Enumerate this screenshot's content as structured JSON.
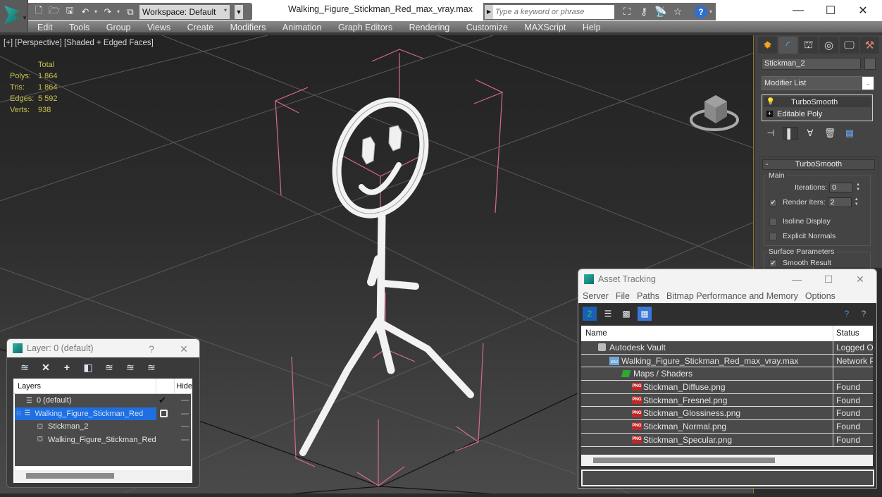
{
  "titlebar": {
    "workspace": "Workspace: Default",
    "document_title": "Walking_Figure_Stickman_Red_max_vray.max",
    "search_placeholder": "Type a keyword or phrase",
    "quick_access": [
      "new-file-icon",
      "open-file-icon",
      "save-icon",
      "undo-icon",
      "redo-icon",
      "project-folder-icon"
    ],
    "search_tools": [
      "binoculars-icon",
      "key-icon",
      "satellite-icon",
      "star-icon"
    ],
    "window_buttons": {
      "minimize": "—",
      "maximize": "☐",
      "close": "✕"
    }
  },
  "menubar": {
    "items": [
      "Edit",
      "Tools",
      "Group",
      "Views",
      "Create",
      "Modifiers",
      "Animation",
      "Graph Editors",
      "Rendering",
      "Customize",
      "MAXScript",
      "Help"
    ]
  },
  "viewport": {
    "label": "[+] [Perspective] [Shaded + Edged Faces]",
    "stats": {
      "header": "Total",
      "rows": [
        {
          "key": "Polys:",
          "value": "1 864"
        },
        {
          "key": "Tris:",
          "value": "1 864"
        },
        {
          "key": "Edges:",
          "value": "5 592"
        },
        {
          "key": "Verts:",
          "value": "938"
        }
      ]
    },
    "accent_color": "#d86a8a"
  },
  "command_panel": {
    "tabs": [
      "create-icon",
      "modify-icon",
      "hierarchy-icon",
      "motion-icon",
      "display-icon",
      "utilities-icon"
    ],
    "object_name": "Stickman_2",
    "modifier_list": "Modifier List",
    "stack": [
      {
        "label": "TurboSmooth",
        "icon": "lightbulb-icon",
        "selected": true
      },
      {
        "label": "Editable Poly",
        "icon": "expand-icon",
        "selected": false
      }
    ],
    "rollout": {
      "title": "TurboSmooth",
      "collapse": "-",
      "main_group": "Main",
      "iterations_label": "Iterations:",
      "iterations_value": "0",
      "render_iters_label": "Render Iters:",
      "render_iters_value": "2",
      "render_iters_checked": true,
      "isoline_label": "Isoline Display",
      "explicit_normals_label": "Explicit Normals",
      "surface_group": "Surface Parameters",
      "smooth_result_label": "Smooth Result"
    }
  },
  "asset_tracking": {
    "title": "Asset Tracking",
    "menu": [
      "Server",
      "File",
      "Paths",
      "Bitmap Performance and Memory",
      "Options"
    ],
    "columns": [
      "Name",
      "Status"
    ],
    "rows": [
      {
        "name": "Autodesk Vault",
        "status": "Logged Ou",
        "icon": "vault",
        "indent": 1
      },
      {
        "name": "Walking_Figure_Stickman_Red_max_vray.max",
        "status": "Network P",
        "icon": "max",
        "indent": 2
      },
      {
        "name": "Maps / Shaders",
        "status": "",
        "icon": "maps",
        "indent": 3
      },
      {
        "name": "Stickman_Diffuse.png",
        "status": "Found",
        "icon": "png",
        "indent": 4
      },
      {
        "name": "Stickman_Fresnel.png",
        "status": "Found",
        "icon": "png",
        "indent": 4
      },
      {
        "name": "Stickman_Glossiness.png",
        "status": "Found",
        "icon": "png",
        "indent": 4
      },
      {
        "name": "Stickman_Normal.png",
        "status": "Found",
        "icon": "png",
        "indent": 4
      },
      {
        "name": "Stickman_Specular.png",
        "status": "Found",
        "icon": "png",
        "indent": 4
      }
    ],
    "window_buttons": {
      "minimize": "—",
      "maximize": "☐",
      "close": "✕"
    }
  },
  "layer_window": {
    "title": "Layer: 0 (default)",
    "help": "?",
    "close": "✕",
    "columns": [
      "Layers",
      "Hide"
    ],
    "rows": [
      {
        "name": "0 (default)",
        "type": "layer",
        "indent": 1,
        "selected": false,
        "current": true
      },
      {
        "name": "Walking_Figure_Stickman_Red",
        "type": "layer",
        "indent": 0,
        "selected": true,
        "current": false
      },
      {
        "name": "Stickman_2",
        "type": "object",
        "indent": 2,
        "selected": false,
        "current": false
      },
      {
        "name": "Walking_Figure_Stickman_Red",
        "type": "object",
        "indent": 2,
        "selected": false,
        "current": false
      }
    ]
  }
}
